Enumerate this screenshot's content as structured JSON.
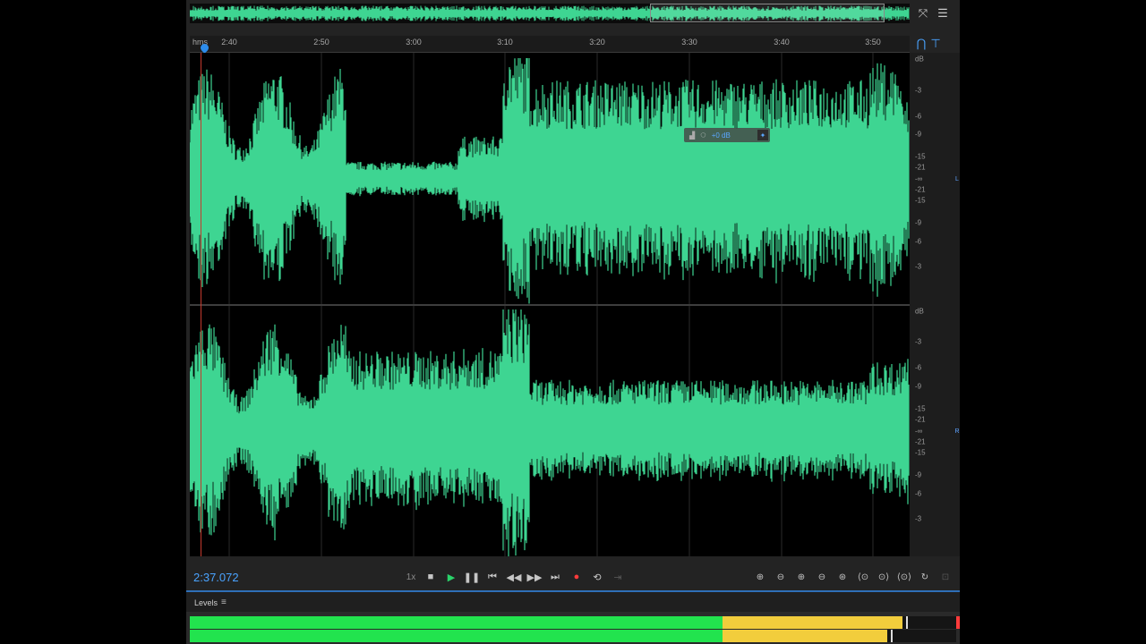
{
  "overview": {
    "navigate_icon": "navigate-icon",
    "menu_icon": "panel-menu-icon"
  },
  "ruler": {
    "units": "hms",
    "labels": [
      "2:40",
      "2:50",
      "3:00",
      "3:10",
      "3:20",
      "3:30",
      "3:40",
      "3:50"
    ]
  },
  "db_scale": {
    "unit": "dB",
    "labels": [
      "-3",
      "-6",
      "-9",
      "-15",
      "-21",
      "-∞",
      "-21",
      "-15",
      "-9",
      "-6",
      "-3"
    ]
  },
  "channels": {
    "left": "L",
    "right": "R"
  },
  "hud": {
    "value": "+0 dB"
  },
  "transport": {
    "time": "2:37.072",
    "speed": "1x",
    "buttons": [
      "stop",
      "play",
      "pause",
      "go-to-previous",
      "rewind",
      "fast-forward",
      "go-to-next",
      "record",
      "loop",
      "skip-selection"
    ]
  },
  "levels": {
    "title": "Levels",
    "left_level": 0.93,
    "right_level": 0.91,
    "left_green": 0.695,
    "right_green": 0.695
  },
  "colors": {
    "waveform": "#3ed592",
    "timecode": "#4aa3ff",
    "meter_green": "#22e34e",
    "meter_yellow": "#f2cd3c",
    "clip": "#ff3b3b",
    "playhead": "#c43a2e"
  }
}
